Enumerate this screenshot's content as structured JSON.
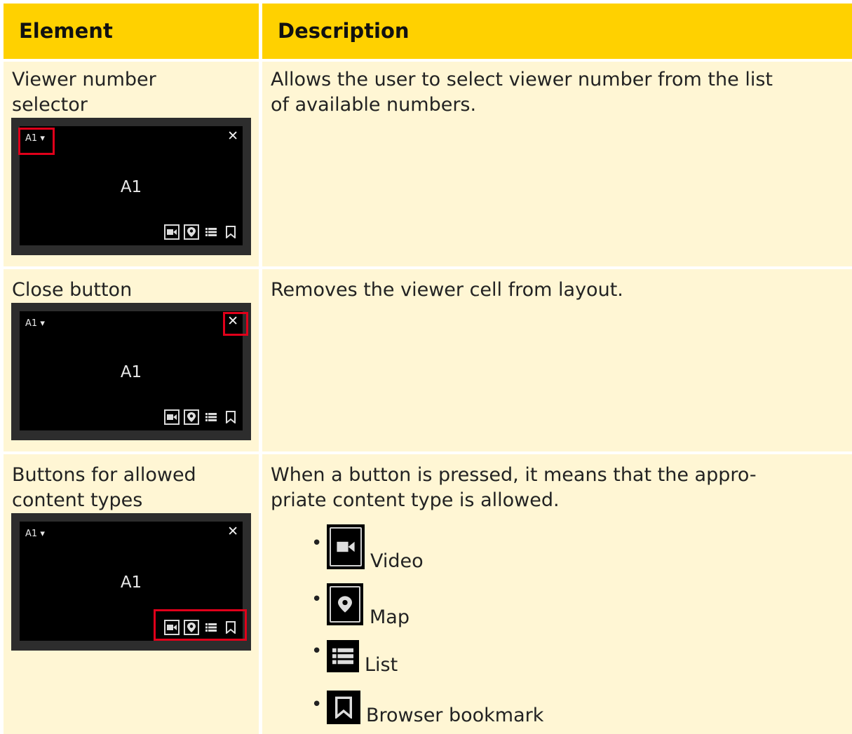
{
  "header": {
    "element": "Element",
    "description": "Description"
  },
  "rows": [
    {
      "element_line1": "Viewer number",
      "element_line2": "selector",
      "desc_line1": "Allows the user to select viewer number from the list",
      "desc_line2": "of available numbers."
    },
    {
      "element_line1": "Close button",
      "desc_line1": "Removes the viewer cell from layout."
    },
    {
      "element_line1": "Buttons for allowed",
      "element_line2": "content types",
      "desc_line1": "When a button is pressed, it means that the appro-",
      "desc_line2": "priate content type is allowed."
    }
  ],
  "viewer": {
    "number": "A1",
    "dropdown_glyph": "▾",
    "close_glyph": "✕",
    "center_label": "A1"
  },
  "content_types": [
    "Video",
    "Map",
    "List",
    "Browser bookmark"
  ],
  "colors": {
    "header": "#ffd100",
    "cell": "#fff6d4",
    "highlight": "#e0001a"
  }
}
